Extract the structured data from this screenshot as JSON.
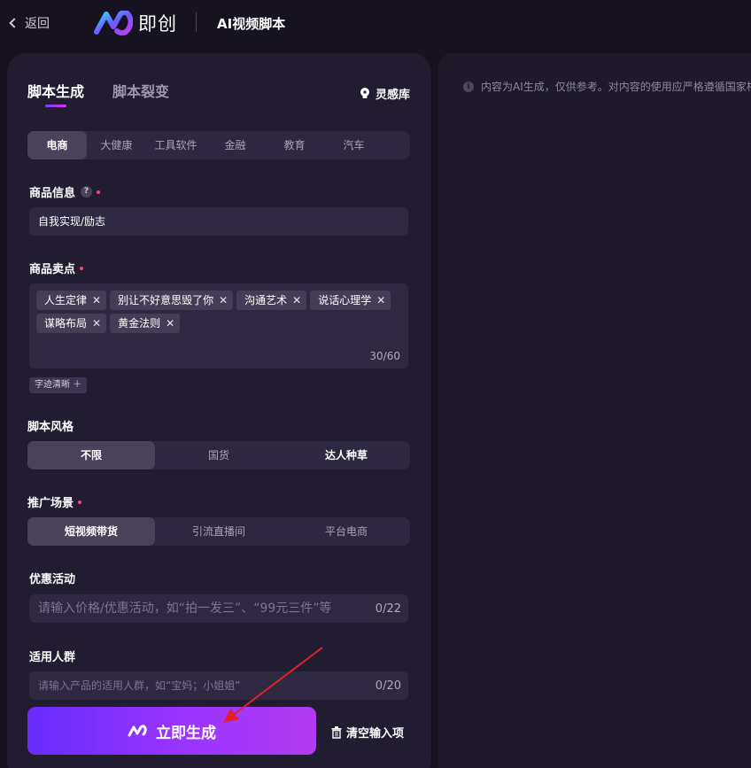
{
  "header": {
    "back_label": "返回",
    "logo_text": "即创",
    "app_title": "AI视频脚本"
  },
  "tabs": [
    {
      "label": "脚本生成",
      "active": true
    },
    {
      "label": "脚本裂变",
      "active": false
    }
  ],
  "inspiration_label": "灵感库",
  "categories": [
    "电商",
    "大健康",
    "工具软件",
    "金融",
    "教育",
    "汽车"
  ],
  "product_info": {
    "label": "商品信息",
    "help": "?",
    "value": "自我实现/励志"
  },
  "selling_points": {
    "label": "商品卖点",
    "tags": [
      "人生定律",
      "别让不好意思毁了你",
      "沟通艺术",
      "说话心理学",
      "谋略布局",
      "黄金法则"
    ],
    "count": "30/60",
    "add_chip": "字迹清晰 ＋"
  },
  "script_style": {
    "label": "脚本风格",
    "options": [
      "不限",
      "国货",
      "达人种草"
    ]
  },
  "scene": {
    "label": "推广场景",
    "options": [
      "短视频带货",
      "引流直播间",
      "平台电商"
    ]
  },
  "promotion": {
    "label": "优惠活动",
    "placeholder": "请输入价格/优惠活动，如“拍一发三”、“99元三件”等",
    "count": "0/22"
  },
  "audience": {
    "label": "适用人群",
    "placeholder": "请输入产品的适用人群，如“宝妈；小姐姐”",
    "count": "0/20"
  },
  "actions": {
    "generate_label": "立即生成",
    "clear_label": "清空输入项"
  },
  "notice": {
    "icon": "i",
    "text": "内容为AI生成，仅供参考。对内容的使用应严格遵循国家相"
  },
  "colors": {
    "accent_start": "#6a2cff",
    "accent_end": "#b23bf0",
    "required_dot": "#ff3c7d",
    "annotation_arrow": "#e0202c"
  }
}
